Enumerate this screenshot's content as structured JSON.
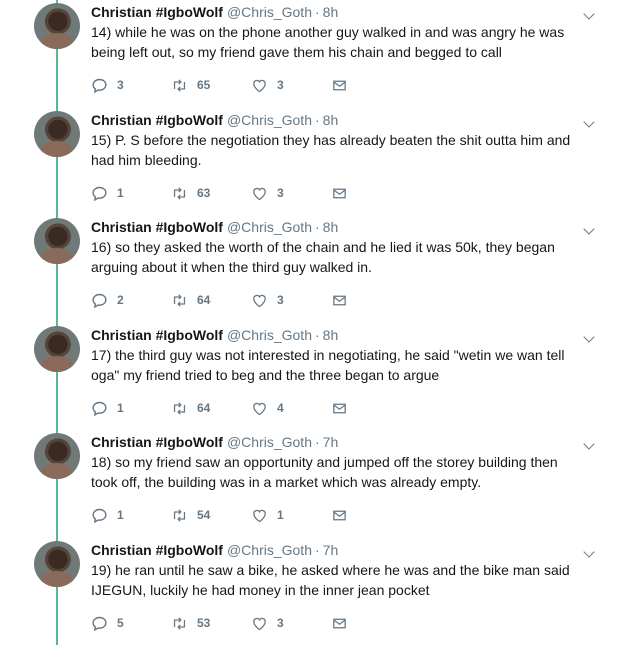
{
  "author": {
    "name": "Christian #IgboWolf",
    "handle": "@Chris_Goth",
    "separator": "·"
  },
  "tweets": [
    {
      "time": "8h",
      "text": "14) while he was on the phone another guy walked in and was angry he was being left out, so my friend gave them his chain and begged to call",
      "replies": "3",
      "retweets": "65",
      "likes": "3"
    },
    {
      "time": "8h",
      "text": "15) P. S before the negotiation they has already beaten the shit outta him and had him bleeding.",
      "replies": "1",
      "retweets": "63",
      "likes": "3"
    },
    {
      "time": "8h",
      "text": "16) so they asked the worth of the chain and he lied it was 50k, they began arguing about it when the third guy walked in.",
      "replies": "2",
      "retweets": "64",
      "likes": "3"
    },
    {
      "time": "8h",
      "text": "17) the third guy was not interested in negotiating, he said \"wetin we wan tell oga\" my friend tried to beg and the three began to argue",
      "replies": "1",
      "retweets": "64",
      "likes": "4"
    },
    {
      "time": "7h",
      "text": "18) so my friend saw an opportunity and jumped off the storey building then took off, the building was in a market which was already empty.",
      "replies": "1",
      "retweets": "54",
      "likes": "1"
    },
    {
      "time": "7h",
      "text": "19) he ran until he saw a bike, he asked where he was and the bike man said IJEGUN, luckily he had money in the inner jean pocket",
      "replies": "5",
      "retweets": "53",
      "likes": "3"
    }
  ],
  "icons": {
    "reply": "reply-icon",
    "retweet": "retweet-icon",
    "like": "heart-icon",
    "dm": "envelope-icon",
    "menu": "chevron-down-icon"
  },
  "colors": {
    "thread_line": "#5ab98c",
    "secondary_text": "#657786",
    "primary_text": "#14171a"
  }
}
